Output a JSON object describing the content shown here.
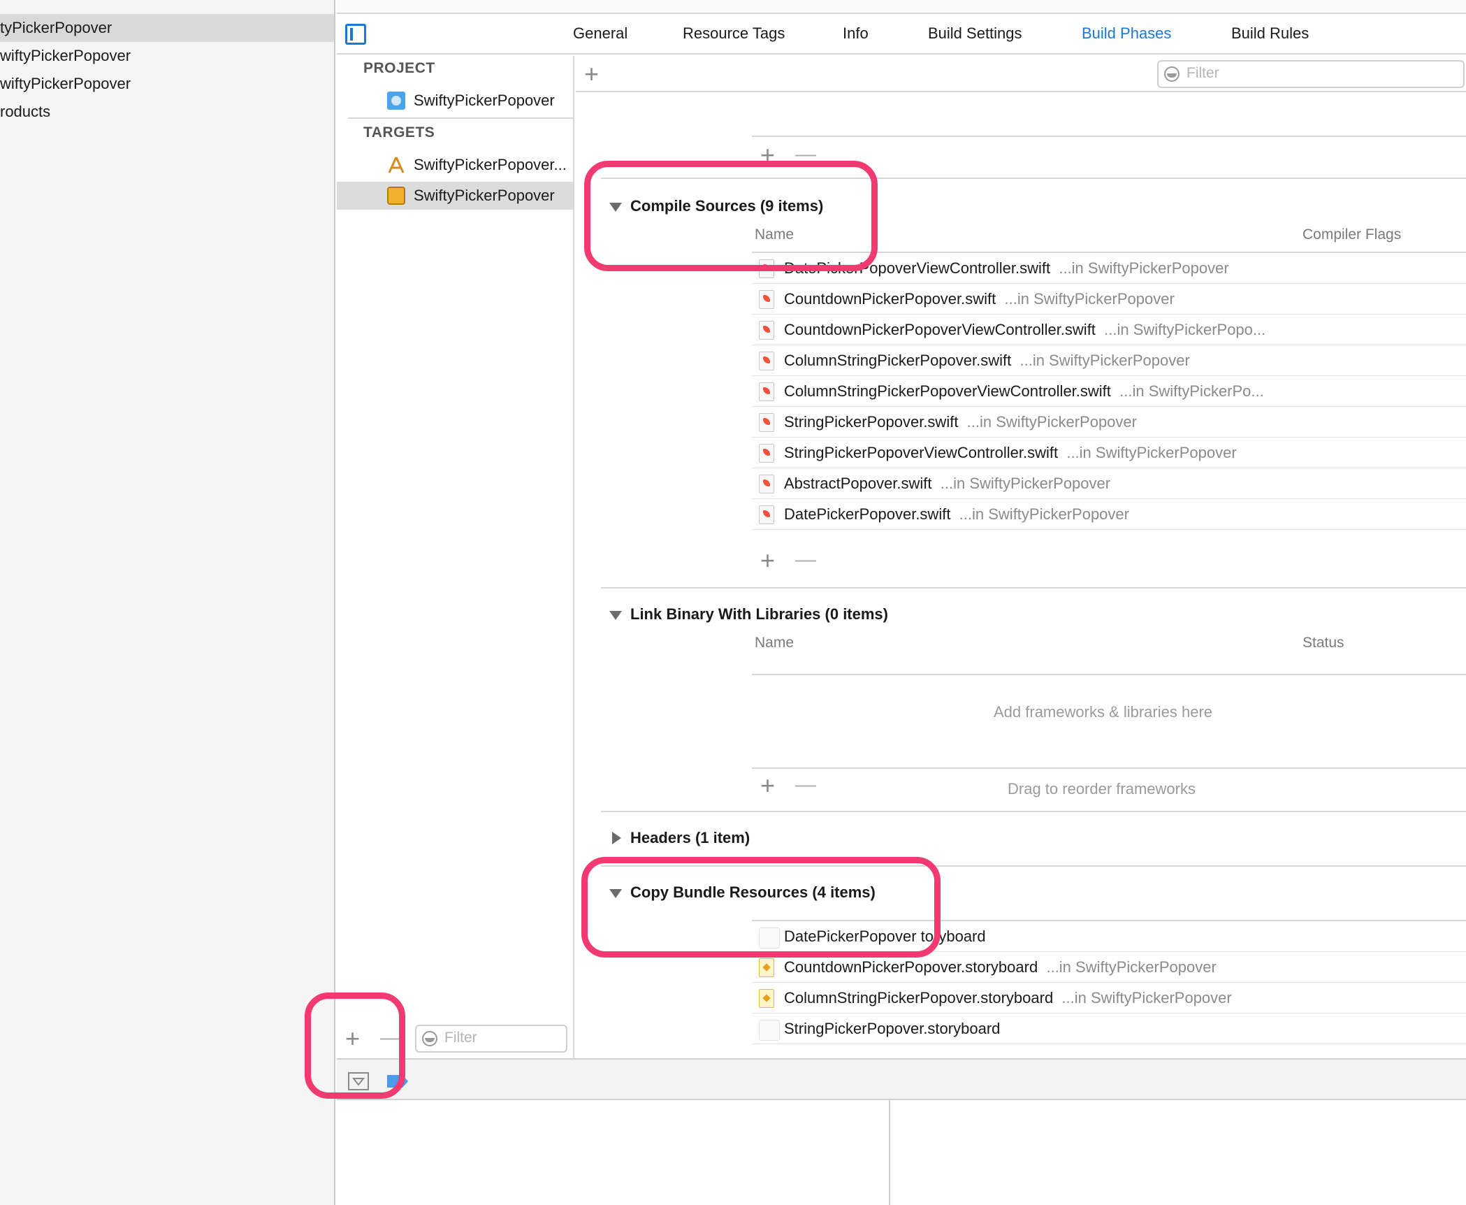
{
  "navigator": {
    "items": [
      {
        "label": "tyPickerPopover",
        "selected": true
      },
      {
        "label": "wiftyPickerPopover",
        "selected": false
      },
      {
        "label": "wiftyPickerPopover",
        "selected": false
      },
      {
        "label": "roducts",
        "selected": false
      }
    ]
  },
  "tabs": [
    {
      "label": "General",
      "active": false
    },
    {
      "label": "Resource Tags",
      "active": false
    },
    {
      "label": "Info",
      "active": false
    },
    {
      "label": "Build Settings",
      "active": false
    },
    {
      "label": "Build Phases",
      "active": true
    },
    {
      "label": "Build Rules",
      "active": false
    }
  ],
  "target_list": {
    "project_header": "PROJECT",
    "project_item": "SwiftyPickerPopover",
    "targets_header": "TARGETS",
    "targets": [
      {
        "label": "SwiftyPickerPopover...",
        "icon": "app-target-icon",
        "selected": false
      },
      {
        "label": "SwiftyPickerPopover",
        "icon": "framework-briefcase-icon",
        "selected": true
      }
    ],
    "filter_placeholder": "Filter"
  },
  "phases": {
    "filter_placeholder": "Filter",
    "compile_sources": {
      "title": "Compile Sources (9 items)",
      "col_name": "Name",
      "col_flags": "Compiler Flags",
      "files": [
        {
          "name": "DatePickerPopoverViewController.swift",
          "location": "...in SwiftyPickerPopover"
        },
        {
          "name": "CountdownPickerPopover.swift",
          "location": "...in SwiftyPickerPopover"
        },
        {
          "name": "CountdownPickerPopoverViewController.swift",
          "location": "...in SwiftyPickerPopo..."
        },
        {
          "name": "ColumnStringPickerPopover.swift",
          "location": "...in SwiftyPickerPopover"
        },
        {
          "name": "ColumnStringPickerPopoverViewController.swift",
          "location": "...in SwiftyPickerPo..."
        },
        {
          "name": "StringPickerPopover.swift",
          "location": "...in SwiftyPickerPopover"
        },
        {
          "name": "StringPickerPopoverViewController.swift",
          "location": "...in SwiftyPickerPopover"
        },
        {
          "name": "AbstractPopover.swift",
          "location": "...in SwiftyPickerPopover"
        },
        {
          "name": "DatePickerPopover.swift",
          "location": "...in SwiftyPickerPopover"
        }
      ]
    },
    "link_binary": {
      "title": "Link Binary With Libraries (0 items)",
      "col_name": "Name",
      "col_status": "Status",
      "empty_hint": "Add frameworks & libraries here",
      "drag_hint": "Drag to reorder frameworks"
    },
    "headers": {
      "title": "Headers (1 item)"
    },
    "copy_bundle": {
      "title": "Copy Bundle Resources (4 items)",
      "files": [
        {
          "name": "DatePickerPopover",
          "name_tail": "toryboard",
          "location": "",
          "icon": "blank"
        },
        {
          "name": "CountdownPickerPopover.storyboard",
          "location": "...in SwiftyPickerPopover",
          "icon": "storyboard"
        },
        {
          "name": "ColumnStringPickerPopover.storyboard",
          "location": "...in SwiftyPickerPopover",
          "icon": "storyboard"
        },
        {
          "name": "StringPickerPopover.storyboard",
          "location": "",
          "icon": "blank"
        }
      ]
    }
  },
  "colors": {
    "accent": "#1b78d8",
    "highlight": "#f23a72"
  }
}
